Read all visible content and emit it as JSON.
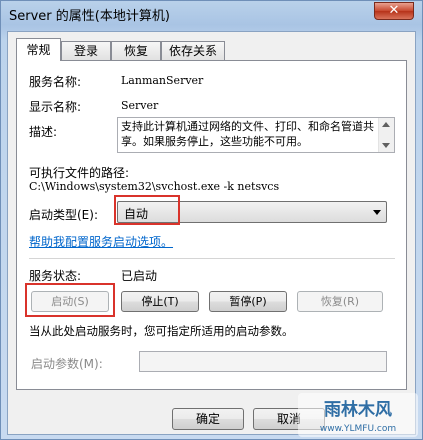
{
  "window": {
    "title": "Server 的属性(本地计算机)",
    "close_glyph": "✕"
  },
  "tabs": [
    {
      "label": "常规",
      "active": true
    },
    {
      "label": "登录",
      "active": false
    },
    {
      "label": "恢复",
      "active": false
    },
    {
      "label": "依存关系",
      "active": false
    }
  ],
  "general": {
    "service_name_label": "服务名称:",
    "service_name_value": "LanmanServer",
    "display_name_label": "显示名称:",
    "display_name_value": "Server",
    "description_label": "描述:",
    "description_value": "支持此计算机通过网络的文件、打印、和命名管道共享。如果服务停止，这些功能不可用。",
    "exe_path_label": "可执行文件的路径:",
    "exe_path_value": "C:\\Windows\\system32\\svchost.exe -k netsvcs",
    "startup_type_label": "启动类型(E):",
    "startup_type_value": "自动",
    "help_link": "帮助我配置服务启动选项。",
    "service_status_label": "服务状态:",
    "service_status_value": "已启动",
    "start_button": "启动(S)",
    "stop_button": "停止(T)",
    "pause_button": "暂停(P)",
    "resume_button": "恢复(R)",
    "start_hint": "当从此处启动服务时，您可指定所适用的启动参数。",
    "start_params_label": "启动参数(M):",
    "start_params_value": ""
  },
  "footer": {
    "ok_button": "确定",
    "cancel_button": "取消"
  },
  "watermark": {
    "text": "雨林木风",
    "url": "www.YLMFU.com"
  },
  "colors": {
    "highlight": "#d9332b",
    "link": "#0066cc",
    "accent": "#a9c4e4"
  }
}
